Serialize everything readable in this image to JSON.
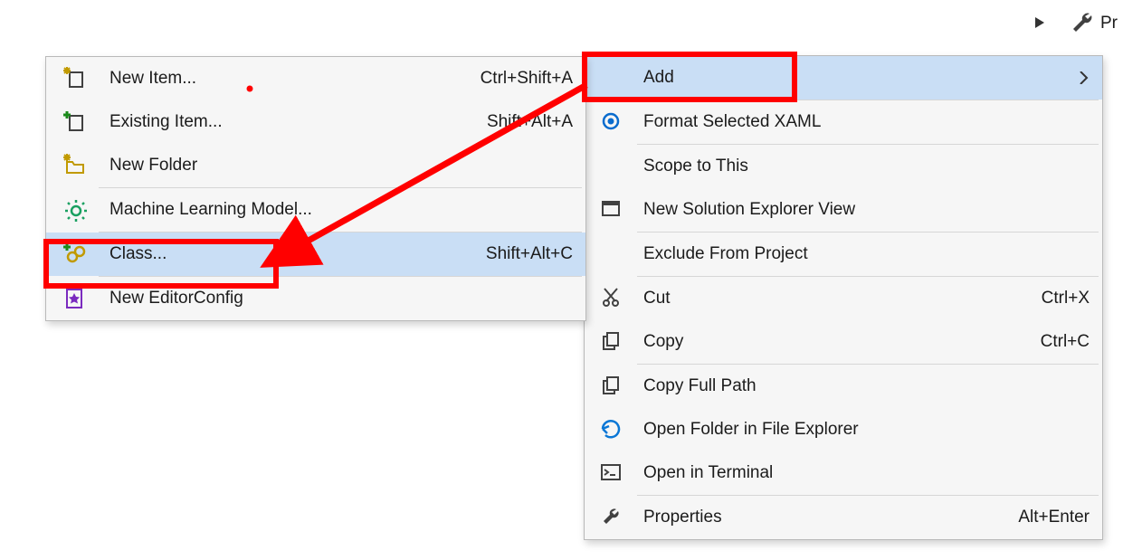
{
  "right_edge": {
    "row0_label": "Pr"
  },
  "primary_menu": {
    "items": [
      {
        "id": "add",
        "label": "Add",
        "shortcut": "",
        "arrow": true,
        "highlight": true,
        "icon": ""
      },
      {
        "sep": true
      },
      {
        "id": "format-xaml",
        "label": "Format Selected XAML",
        "shortcut": "",
        "icon": "target"
      },
      {
        "sep": true
      },
      {
        "id": "scope",
        "label": "Scope to This",
        "shortcut": ""
      },
      {
        "id": "new-view",
        "label": "New Solution Explorer View",
        "shortcut": "",
        "icon": "window"
      },
      {
        "sep": true
      },
      {
        "id": "exclude",
        "label": "Exclude From Project",
        "shortcut": ""
      },
      {
        "sep": true
      },
      {
        "id": "cut",
        "label": "Cut",
        "shortcut": "Ctrl+X",
        "icon": "scissors"
      },
      {
        "id": "copy",
        "label": "Copy",
        "shortcut": "Ctrl+C",
        "icon": "copy"
      },
      {
        "sep": true
      },
      {
        "id": "copy-path",
        "label": "Copy Full Path",
        "shortcut": "",
        "icon": "copy-path"
      },
      {
        "id": "open-folder",
        "label": "Open Folder in File Explorer",
        "shortcut": "",
        "icon": "open-arrow"
      },
      {
        "id": "open-term",
        "label": "Open in Terminal",
        "shortcut": "",
        "icon": "terminal"
      },
      {
        "sep": true
      },
      {
        "id": "properties",
        "label": "Properties",
        "shortcut": "Alt+Enter",
        "icon": "wrench"
      }
    ]
  },
  "sub_menu": {
    "items": [
      {
        "id": "new-item",
        "label": "New Item...",
        "shortcut": "Ctrl+Shift+A",
        "icon": "new-item"
      },
      {
        "id": "existing-item",
        "label": "Existing Item...",
        "shortcut": "Shift+Alt+A",
        "icon": "existing-item"
      },
      {
        "id": "new-folder",
        "label": "New Folder",
        "shortcut": "",
        "icon": "new-folder"
      },
      {
        "sep": true
      },
      {
        "id": "ml-model",
        "label": "Machine Learning Model...",
        "shortcut": "",
        "icon": "gear-sparkle"
      },
      {
        "sep": true
      },
      {
        "id": "class",
        "label": "Class...",
        "shortcut": "Shift+Alt+C",
        "icon": "class",
        "highlight": true
      },
      {
        "sep": true
      },
      {
        "id": "editorconfig",
        "label": "New EditorConfig",
        "shortcut": "",
        "icon": "star-file"
      }
    ]
  }
}
